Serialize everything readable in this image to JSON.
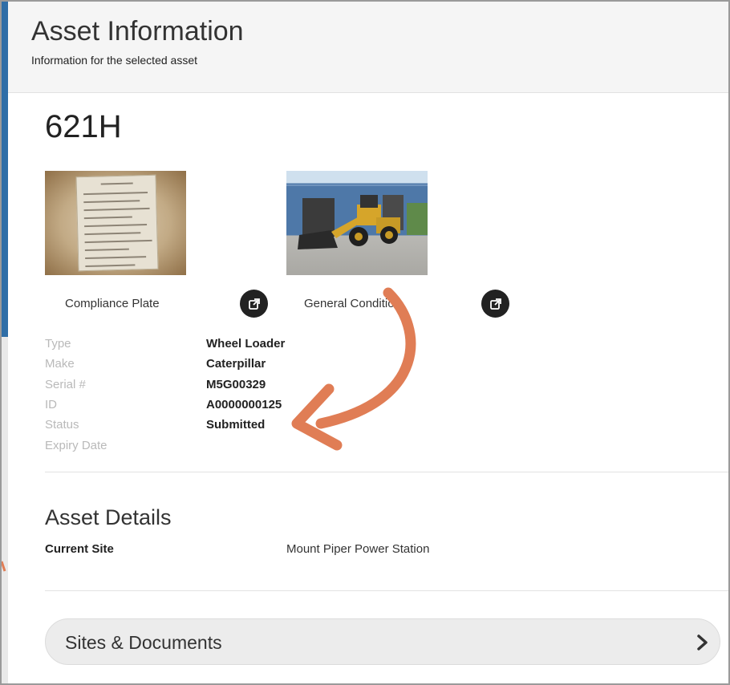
{
  "header": {
    "title": "Asset Information",
    "subtitle": "Information for the selected asset"
  },
  "asset": {
    "id": "621H"
  },
  "photos": [
    {
      "caption": "Compliance Plate",
      "icon": "external-link-icon"
    },
    {
      "caption": "General Condition",
      "icon": "external-link-icon"
    }
  ],
  "properties": [
    {
      "label": "Type",
      "value": "Wheel Loader"
    },
    {
      "label": "Make",
      "value": "Caterpillar"
    },
    {
      "label": "Serial #",
      "value": "M5G00329"
    },
    {
      "label": "ID",
      "value": "A0000000125"
    },
    {
      "label": "Status",
      "value": "Submitted"
    },
    {
      "label": "Expiry Date",
      "value": ""
    }
  ],
  "details": {
    "title": "Asset Details",
    "current_site_label": "Current Site",
    "current_site_value": "Mount Piper Power Station"
  },
  "sites_documents": {
    "label": "Sites & Documents",
    "icon": "chevron-right-icon"
  },
  "colors": {
    "annotation_arrow": "#e07d55",
    "header_bg": "#f5f5f5",
    "label_gray": "#b9b9b9"
  }
}
